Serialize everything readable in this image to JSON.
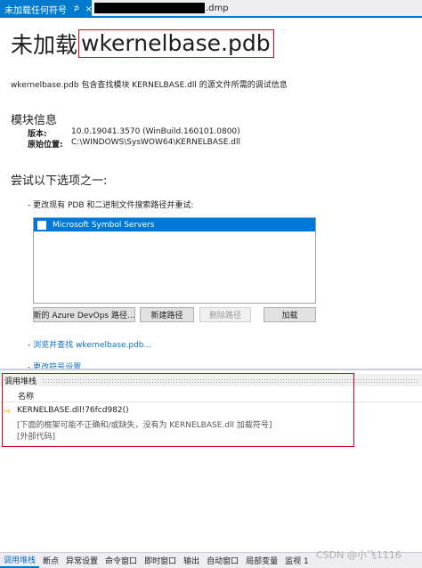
{
  "tabs": {
    "active": "未加载任何符号",
    "pin": "⊅",
    "close": "×",
    "file_suffix": ".dmp"
  },
  "page": {
    "title_prefix": "未加载",
    "title_file": "wkernelbase.pdb",
    "description": "wkernelbase.pdb 包含查找模块 KERNELBASE.dll 的源文件所需的调试信息"
  },
  "module_info": {
    "heading": "模块信息",
    "version_label": "版本:",
    "version_value": "10.0.19041.3570 (WinBuild.160101.0800)",
    "location_label": "原始位置:",
    "location_value": "C:\\WINDOWS\\SysWOW64\\KERNELBASE.dll"
  },
  "options": {
    "heading": "尝试以下选项之一:",
    "change_paths": "-  更改现有 PDB 和二进制文件搜索路径并重试:",
    "list_items": [
      "Microsoft Symbol Servers"
    ],
    "btn_azure": "新的 Azure DevOps 路径...",
    "btn_new_path": "新建路径",
    "btn_delete_path": "删除路径",
    "btn_load": "加载",
    "browse_prefix": "-  ",
    "browse_link": "浏览并查找 wkernelbase.pdb...",
    "settings_prefix": "-  ",
    "settings_link": "更改符号设置..."
  },
  "call_stack": {
    "title": "调用堆栈",
    "column_name": "名称",
    "lines": [
      "KERNELBASE.dll!76fcd982()",
      "[下面的框架可能不正确和/或缺失，没有为 KERNELBASE.dll 加载符号]",
      "[外部代码]"
    ]
  },
  "bottom_tabs": [
    "调用堆栈",
    "断点",
    "异常设置",
    "命令窗口",
    "即时窗口",
    "输出",
    "自动窗口",
    "局部变量",
    "监视 1"
  ],
  "watermark": "CSDN @小飞1116"
}
